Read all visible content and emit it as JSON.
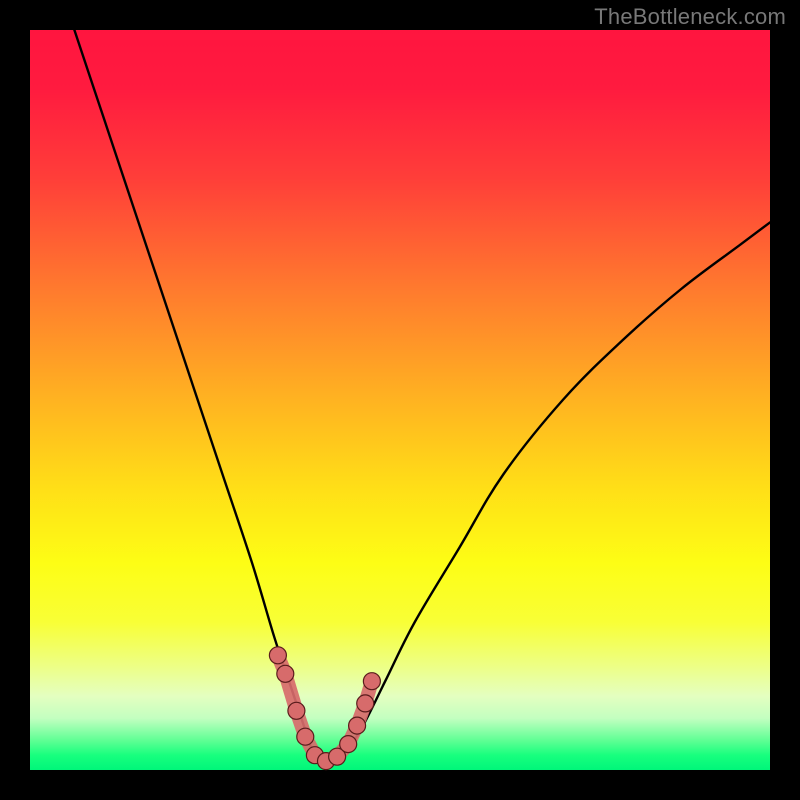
{
  "watermark": "TheBottleneck.com",
  "colors": {
    "frame": "#000000",
    "gradient_stops": [
      {
        "offset": 0.0,
        "color": "#ff153f"
      },
      {
        "offset": 0.08,
        "color": "#ff1b3f"
      },
      {
        "offset": 0.2,
        "color": "#ff3e39"
      },
      {
        "offset": 0.35,
        "color": "#ff7a2e"
      },
      {
        "offset": 0.5,
        "color": "#ffb321"
      },
      {
        "offset": 0.62,
        "color": "#ffdf17"
      },
      {
        "offset": 0.72,
        "color": "#fdfd15"
      },
      {
        "offset": 0.8,
        "color": "#f8ff36"
      },
      {
        "offset": 0.86,
        "color": "#edff86"
      },
      {
        "offset": 0.9,
        "color": "#e4ffc0"
      },
      {
        "offset": 0.93,
        "color": "#c3ffc0"
      },
      {
        "offset": 0.96,
        "color": "#5fff94"
      },
      {
        "offset": 0.98,
        "color": "#18ff7e"
      },
      {
        "offset": 1.0,
        "color": "#00f67a"
      }
    ],
    "curve": "#000000",
    "marker_fill": "#d76b6b",
    "marker_stroke": "#5a1c1c"
  },
  "chart_data": {
    "type": "line",
    "title": "",
    "xlabel": "",
    "ylabel": "",
    "xlim": [
      0,
      100
    ],
    "ylim": [
      0,
      100
    ],
    "grid": false,
    "series": [
      {
        "name": "bottleneck-curve",
        "x": [
          6,
          10,
          14,
          18,
          22,
          26,
          30,
          33,
          35,
          37,
          38,
          39,
          40,
          41,
          43,
          45,
          48,
          52,
          58,
          64,
          72,
          80,
          88,
          96,
          100
        ],
        "y": [
          100,
          88,
          76,
          64,
          52,
          40,
          28,
          18,
          12,
          6,
          3,
          1.5,
          1,
          1.5,
          3,
          6,
          12,
          20,
          30,
          40,
          50,
          58,
          65,
          71,
          74
        ]
      }
    ],
    "markers": {
      "name": "highlighted-points",
      "x": [
        33.5,
        34.5,
        36.0,
        37.2,
        38.5,
        40.0,
        41.5,
        43.0,
        44.2,
        45.3,
        46.2
      ],
      "y": [
        15.5,
        13.0,
        8.0,
        4.5,
        2.0,
        1.2,
        1.8,
        3.5,
        6.0,
        9.0,
        12.0
      ]
    }
  }
}
